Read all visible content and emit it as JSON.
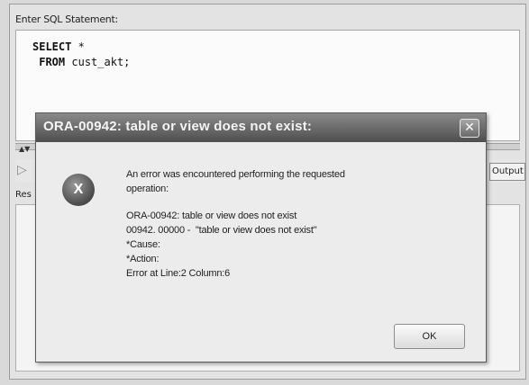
{
  "editor": {
    "label": "Enter SQL Statement:",
    "line1_keyword": "SELECT",
    "line1_rest": " *",
    "line2_keyword": "FROM",
    "line2_rest": " cust_akt;"
  },
  "toolbar": {
    "run_icon": "run-icon",
    "output_tab": "Output"
  },
  "results": {
    "label": "Res"
  },
  "dialog": {
    "title": "ORA-00942: table or view does not exist:",
    "close_glyph": "✕",
    "icon_glyph": "X",
    "message_line1": "An error was encountered performing the requested",
    "message_line2": "operation:",
    "detail_line1": "ORA-00942: table or view does not exist",
    "detail_line2": "00942. 00000 -  \"table or view does not exist\"",
    "detail_line3": "*Cause:",
    "detail_line4": "*Action:",
    "detail_line5": "Error at Line:2 Column:6",
    "ok_label": "OK"
  }
}
